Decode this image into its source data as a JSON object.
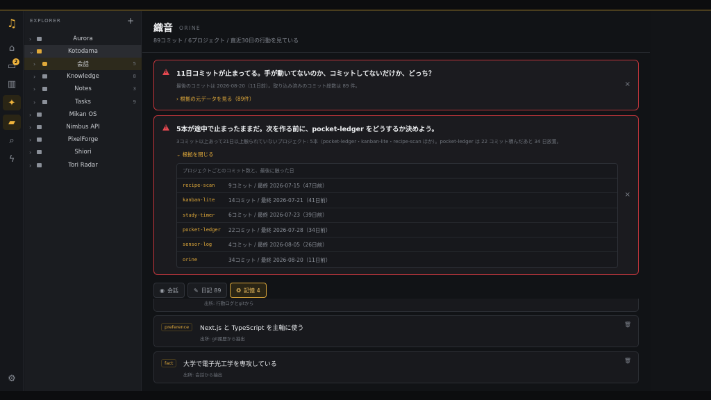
{
  "explorer": {
    "title": "EXPLORER",
    "add": "+",
    "items": [
      {
        "label": "Aurora"
      },
      {
        "label": "Kotodama"
      },
      {
        "label": "会話",
        "count": "5"
      },
      {
        "label": "Knowledge",
        "count": "8"
      },
      {
        "label": "Notes",
        "count": "3"
      },
      {
        "label": "Tasks",
        "count": "9"
      },
      {
        "label": "Mikan OS"
      },
      {
        "label": "Nimbus API"
      },
      {
        "label": "PixelForge"
      },
      {
        "label": "Shiori"
      },
      {
        "label": "Tori Radar"
      }
    ]
  },
  "rail": {
    "badge": "2"
  },
  "header": {
    "title": "織音",
    "subtitle": "ORINE",
    "meta": "89コミット / 6プロジェクト / 直近30日の行動を見ている"
  },
  "alert1": {
    "title": "11日コミットが止まってる。手が動いてないのか、コミットしてないだけか、どっち？",
    "text": "最後のコミットは 2026-08-20（11日前）。取り込み済みのコミット総数は 89 件。",
    "link": "根拠の元データを見る（89件）"
  },
  "alert2": {
    "title": "5本が途中で止まったままだ。次を作る前に、pocket-ledger をどうするか決めよう。",
    "text": "3コミット以上あって21日以上触られていないプロジェクト: 5本（pocket-ledger・kanban-lite・recipe-scan ほか）。pocket-ledger は 22 コミット積んだあと 34 日放置。",
    "link": "根拠を閉じる",
    "evidence_header": "プロジェクトごとのコミット数と、最後に触った日",
    "rows": [
      {
        "name": "recipe-scan",
        "value": "9コミット / 最終 2026-07-15（47日前）"
      },
      {
        "name": "kanban-lite",
        "value": "14コミット / 最終 2026-07-21（41日前）"
      },
      {
        "name": "study-timer",
        "value": "6コミット / 最終 2026-07-23（39日前）"
      },
      {
        "name": "pocket-ledger",
        "value": "22コミット / 最終 2026-07-28（34日前）"
      },
      {
        "name": "sensor-log",
        "value": "4コミット / 最終 2026-08-05（26日前）"
      },
      {
        "name": "orine",
        "value": "34コミット / 最終 2026-08-20（11日前）"
      }
    ]
  },
  "tabs": [
    {
      "label": "会話"
    },
    {
      "label": "日記 89"
    },
    {
      "label": "記憶 4"
    }
  ],
  "memories": {
    "partial_src": "出所: 行動ログとgitから",
    "items": [
      {
        "tag": "preference",
        "text": "Next.js と TypeScript を主軸に使う",
        "src": "出所: git履歴から抽出"
      },
      {
        "tag": "fact",
        "text": "大学で電子光工学を専攻している",
        "src": "出所: 会話から抽出"
      }
    ]
  }
}
